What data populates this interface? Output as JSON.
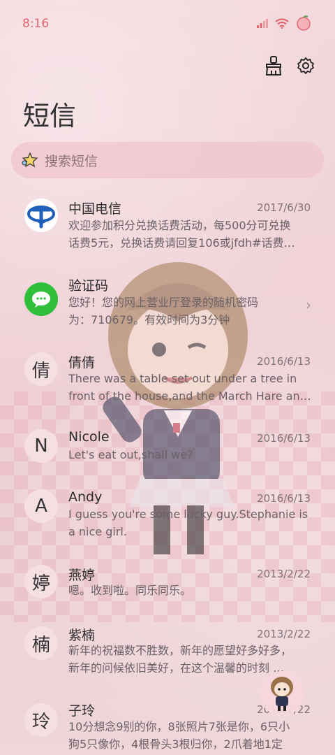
{
  "status_bar": {
    "time": "8:16",
    "accent": "#e0656f"
  },
  "header": {
    "title": "短信"
  },
  "search": {
    "placeholder": "搜索短信"
  },
  "messages": [
    {
      "name": "中国电信",
      "date": "2017/6/30",
      "avatar_type": "china-telecom-logo",
      "preview_lines": [
        "欢迎参加积分兑换话费活动，每500分可兑换",
        "话费5元，兑换话费请回复106或jfdh#话费…"
      ]
    },
    {
      "name": "验证码",
      "date": "",
      "avatar_type": "message-bubble-icon",
      "has_chevron": true,
      "preview_lines": [
        "您好！您的网上营业厅登录的随机密码",
        "为：710679。有效时间为3分钟"
      ]
    },
    {
      "name": "倩倩",
      "date": "2016/6/13",
      "avatar_char": "倩",
      "preview_lines": [
        "There was a table set out under a tree in",
        "front of the house,and the March Hare an…"
      ]
    },
    {
      "name": "Nicole",
      "date": "2016/6/13",
      "avatar_char": "N",
      "preview_lines": [
        "Let's eat out,shall we?"
      ]
    },
    {
      "name": "Andy",
      "date": "2016/6/13",
      "avatar_char": "A",
      "preview_lines": [
        "I guess you're some lucky guy.Stephanie is",
        "a nice girl."
      ]
    },
    {
      "name": "燕婷",
      "date": "2013/2/22",
      "avatar_char": "婷",
      "preview_lines": [
        "嗯。收到啦。同乐同乐。"
      ]
    },
    {
      "name": "紫楠",
      "date": "2013/2/22",
      "avatar_char": "楠",
      "preview_lines": [
        "新年的祝福数不胜数，新年的愿望好多好多，",
        "新年的问候依旧美好，在这个温馨的时刻 …"
      ]
    },
    {
      "name": "子玲",
      "date": "2013/2/22",
      "avatar_char": "玲",
      "preview_lines": [
        "10分想念9别的你，8张照片7张是你，6只小",
        "狗5只像你，4根骨头3根归你，2爪着地1定"
      ]
    }
  ]
}
